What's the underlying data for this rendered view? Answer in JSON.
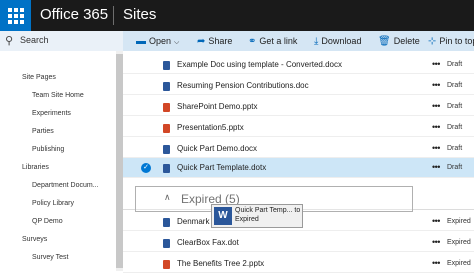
{
  "suite_bar": {
    "brand": "Office 365",
    "app": "Sites"
  },
  "command_bar": {
    "search": "Search",
    "open": "Open",
    "share": "Share",
    "get_link": "Get a link",
    "download": "Download",
    "delete": "Delete",
    "pin": "Pin to top"
  },
  "left_nav": [
    "Site Pages",
    "Team Site Home",
    "Experiments",
    "Parties",
    "Publishing",
    "Libraries",
    "Department Docum...",
    "Policy Library",
    "QP Demo",
    "Surveys",
    "Survey Test"
  ],
  "files": [
    {
      "name": "Example Doc using template - Converted.docx",
      "type": "word",
      "status": "Draft"
    },
    {
      "name": "Resuming Pension Contributions.doc",
      "type": "word",
      "status": "Draft"
    },
    {
      "name": "SharePoint Demo.pptx",
      "type": "powerpoint",
      "status": "Draft"
    },
    {
      "name": "Presentation5.pptx",
      "type": "powerpoint",
      "status": "Draft"
    },
    {
      "name": "Quick Part Demo.docx",
      "type": "word",
      "status": "Draft"
    },
    {
      "name": "Quick Part Template.dotx",
      "type": "word",
      "status": "Draft"
    }
  ],
  "group": {
    "label": "Expired (5)"
  },
  "expired_files": [
    {
      "name": "Denmark",
      "type": "word",
      "status": "Expired"
    },
    {
      "name": "ClearBox Fax.dot",
      "type": "word",
      "status": "Expired"
    },
    {
      "name": "The Benefits Tree 2.pptx",
      "type": "powerpoint",
      "status": "Expired"
    }
  ],
  "drag_tooltip": {
    "line1": "Quick Part Temp... to",
    "line2": "Expired",
    "icon_letter": "W"
  },
  "row_action_glyph": "•••",
  "colors": {
    "accent": "#0072c6",
    "word": "#2b579a",
    "powerpoint": "#d24726",
    "selected_row": "#cde6f7"
  }
}
